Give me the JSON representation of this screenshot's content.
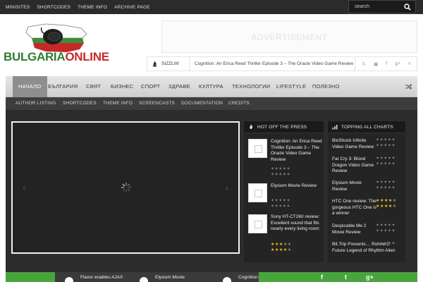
{
  "topnav": [
    "MINISITES",
    "SHORTCODES",
    "THEME INFO",
    "ARCHIVE PAGE"
  ],
  "search": {
    "placeholder": "search"
  },
  "logo": {
    "part1": "BULGARIA",
    "part2": "ONLINE"
  },
  "ad": {
    "label": "ADVERTISEMENT"
  },
  "ticker": {
    "label": "SIZZLIN'",
    "text": "Cognition: An Erica Reed Thriller Episode 3 – The Oracle Video Game Review",
    "social": [
      "twitter-icon",
      "instagram-icon",
      "facebook-icon",
      "googleplus-icon",
      "vimeo-icon"
    ]
  },
  "mainnav": [
    "НАЧАЛО",
    "БЪЛГАРИЯ",
    "СВЯТ",
    "БИЗНЕС",
    "СПОРТ",
    "ЗДРАВЕ",
    "КУЛТУРА",
    "ТЕХНОЛОГИИ",
    "LIFESTYLE",
    "ПОЛЕЗНО"
  ],
  "subnav": [
    "AUTHOR LISTING",
    "SHORTCODES",
    "THEME INFO",
    "SCREENCASTS",
    "DOCUMENTATION",
    "CREDITS"
  ],
  "press": {
    "title": "HOT OFF THE PRESS",
    "items": [
      {
        "title": "Cognition: An Erica Reed Thriller Episode 3 – The Oracle Video Game Review",
        "rating1": 0,
        "rating2": 0
      },
      {
        "title": "Elysium Movie Review",
        "rating1": 0,
        "rating2": 0
      },
      {
        "title": "Sony HT-CT260 review: Excellent sound that fits nearly every living room",
        "rating1": 3,
        "rating2": 4
      }
    ]
  },
  "charts": {
    "title": "TOPPING ALL CHARTS",
    "items": [
      {
        "title": "BioShock Infinite Video Game Review",
        "rating1": 0,
        "rating2": 0
      },
      {
        "title": "Far Cry 3: Blood Dragon Video Game Review",
        "rating1": 0,
        "rating2": 0
      },
      {
        "title": "Elysium Movie Review",
        "rating1": 0,
        "rating2": 0
      },
      {
        "title": "HTC One review: The gorgeous HTC One is a winner",
        "rating1": 4,
        "rating2": 4
      },
      {
        "title": "Despicable Me 2 Movie Review",
        "rating1": 0,
        "rating2": 0
      },
      {
        "title": "Bit.Trip Presents… Runner2: Future Legend of Rhythm Alien",
        "rating1": 0,
        "rating2": 0
      }
    ]
  },
  "footer": {
    "items": [
      "Flavor enables AJAX",
      "Elysium Movie",
      "Cognition: A"
    ],
    "social": [
      "facebook-icon",
      "twitter-icon",
      "googleplus-icon"
    ]
  },
  "colors": {
    "accent_green": "#49a43e",
    "dark": "#2c2c2c",
    "star": "#f0c419"
  }
}
